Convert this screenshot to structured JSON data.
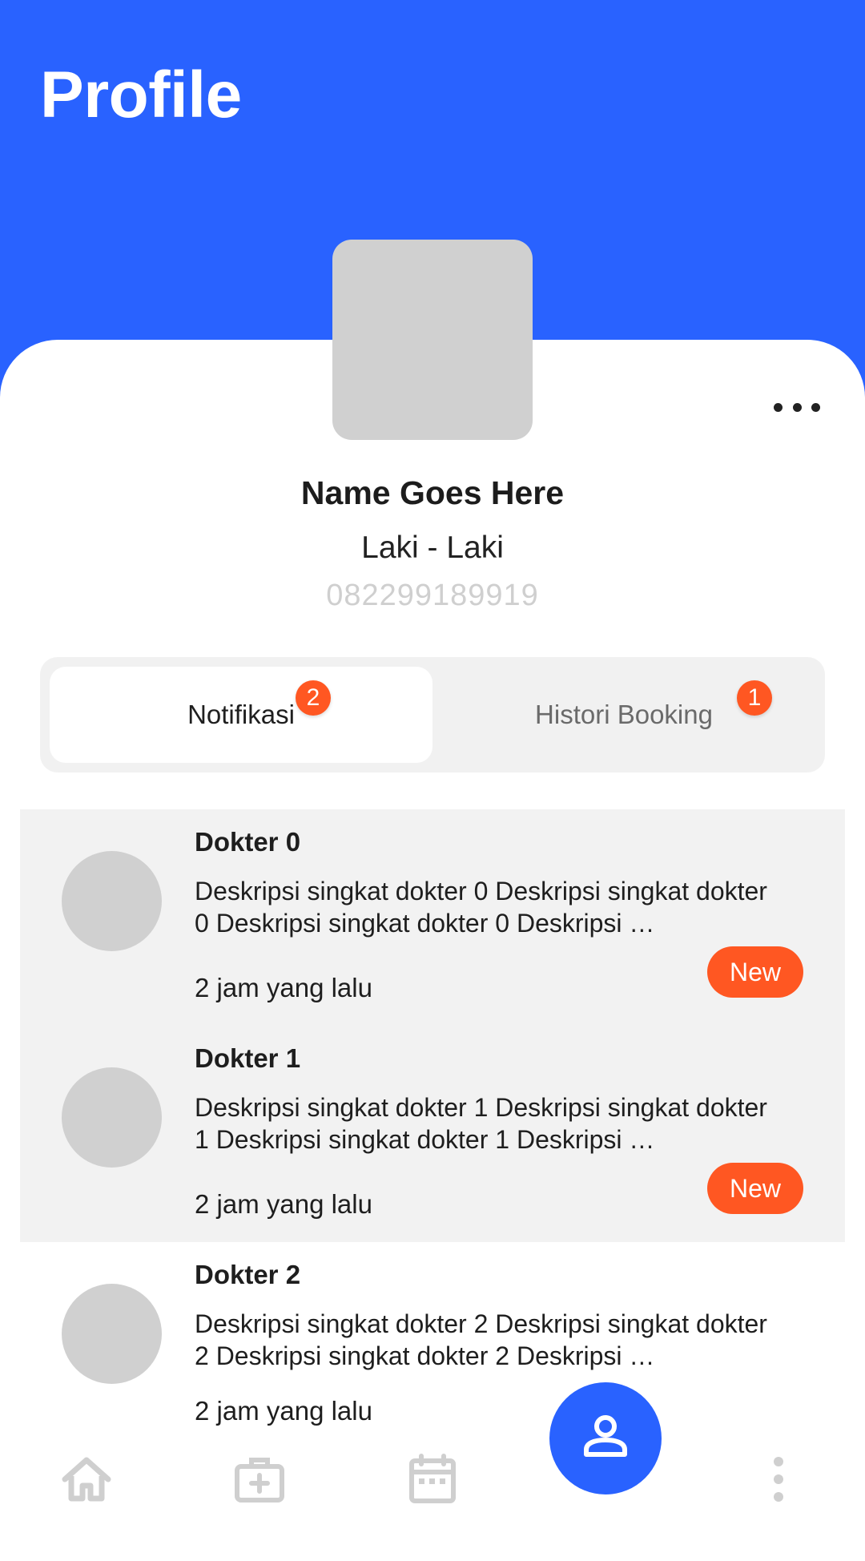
{
  "header": {
    "title": "Profile"
  },
  "profile": {
    "name": "Name Goes Here",
    "gender": "Laki - Laki",
    "phone": "082299189919"
  },
  "tabs": [
    {
      "label": "Notifikasi",
      "badge": "2",
      "active": true
    },
    {
      "label": "Histori Booking",
      "badge": "1",
      "active": false
    }
  ],
  "notifications": [
    {
      "title": "Dokter 0",
      "description": "Deskripsi singkat dokter 0 Deskripsi singkat dokter 0 Deskripsi singkat dokter 0 Deskripsi …",
      "time": "2 jam yang lalu",
      "badge": "New"
    },
    {
      "title": "Dokter 1",
      "description": "Deskripsi singkat dokter 1 Deskripsi singkat dokter 1 Deskripsi singkat dokter 1 Deskripsi …",
      "time": "2 jam yang lalu",
      "badge": "New"
    },
    {
      "title": "Dokter 2",
      "description": "Deskripsi singkat dokter 2 Deskripsi singkat dokter 2 Deskripsi singkat dokter 2 Deskripsi …",
      "time": "2 jam yang lalu"
    }
  ],
  "nav": {
    "items": [
      "home-icon",
      "medical-kit-icon",
      "calendar-icon",
      "profile-icon",
      "more-vertical-icon"
    ],
    "active": "profile-icon"
  },
  "colors": {
    "primary": "#2962ff",
    "accent": "#ff5722",
    "unread_bg": "#f2f2f2",
    "placeholder": "#d0d0d0"
  }
}
